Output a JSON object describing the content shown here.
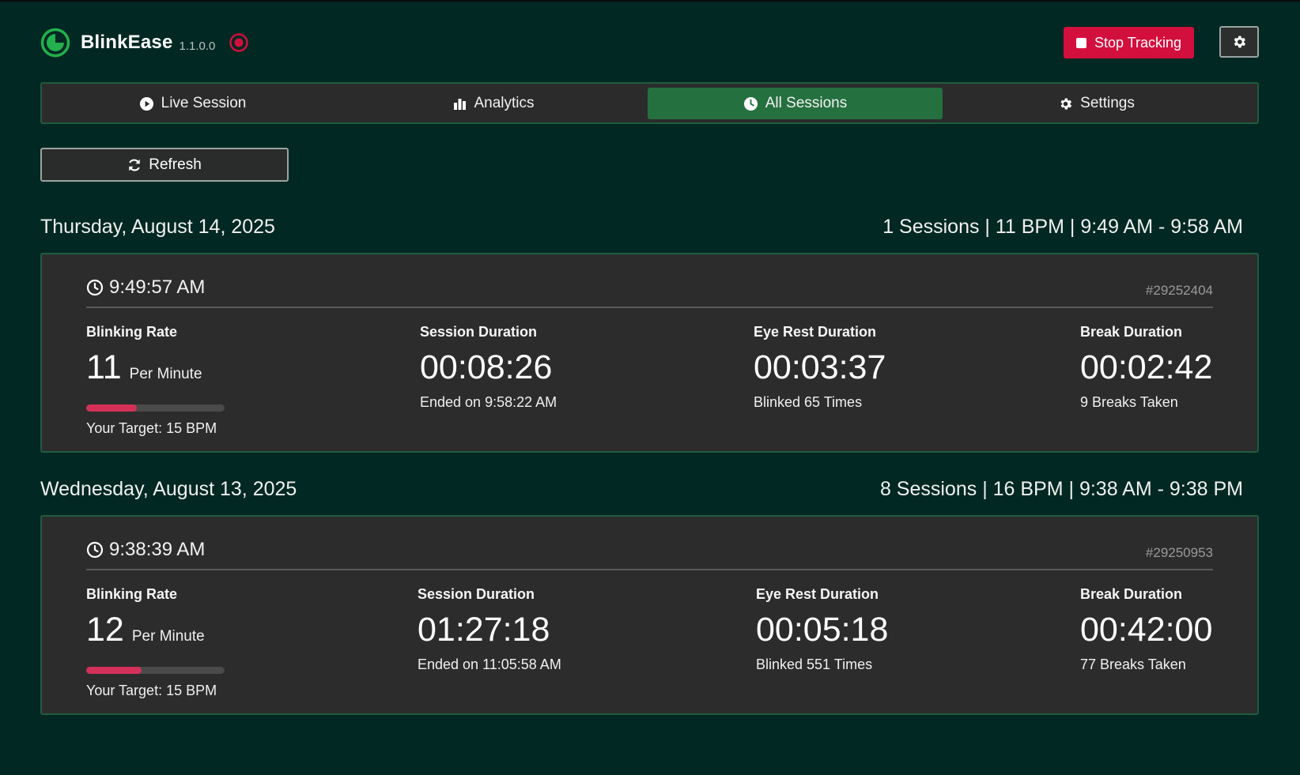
{
  "app": {
    "name": "BlinkEase",
    "version": "1.1.0.0"
  },
  "header": {
    "stop_label": "Stop Tracking"
  },
  "tabs": [
    {
      "label": "Live Session",
      "icon": "play-circle-icon",
      "active": false
    },
    {
      "label": "Analytics",
      "icon": "bar-chart-icon",
      "active": false
    },
    {
      "label": "All Sessions",
      "icon": "clock-icon",
      "active": true
    },
    {
      "label": "Settings",
      "icon": "gear-icon",
      "active": false
    }
  ],
  "refresh_label": "Refresh",
  "colors": {
    "background": "#012822",
    "accent": "#24703f",
    "danger": "#d30f3e",
    "card": "#2c2c2c",
    "rate_bar": "#d3315a"
  },
  "days": [
    {
      "date": "Thursday, August 14, 2025",
      "summary": "1 Sessions | 11 BPM | 9:49 AM - 9:58 AM",
      "session": {
        "start": "9:49:57 AM",
        "id": "#29252404",
        "blink_label": "Blinking Rate",
        "blink_rate": "11",
        "blink_unit": "Per Minute",
        "rate_fraction": 0.3667,
        "target": "Your Target: 15 BPM",
        "duration_label": "Session Duration",
        "duration": "00:08:26",
        "ended": "Ended on 9:58:22 AM",
        "rest_label": "Eye Rest Duration",
        "rest": "00:03:37",
        "blinks": "Blinked 65 Times",
        "break_label": "Break Duration",
        "break": "00:02:42",
        "breaks": "9 Breaks Taken"
      }
    },
    {
      "date": "Wednesday, August 13, 2025",
      "summary": "8 Sessions | 16 BPM | 9:38 AM - 9:38 PM",
      "session": {
        "start": "9:38:39 AM",
        "id": "#29250953",
        "blink_label": "Blinking Rate",
        "blink_rate": "12",
        "blink_unit": "Per Minute",
        "rate_fraction": 0.4,
        "target": "Your Target: 15 BPM",
        "duration_label": "Session Duration",
        "duration": "01:27:18",
        "ended": "Ended on 11:05:58 AM",
        "rest_label": "Eye Rest Duration",
        "rest": "00:05:18",
        "blinks": "Blinked 551 Times",
        "break_label": "Break Duration",
        "break": "00:42:00",
        "breaks": "77 Breaks Taken"
      }
    }
  ]
}
